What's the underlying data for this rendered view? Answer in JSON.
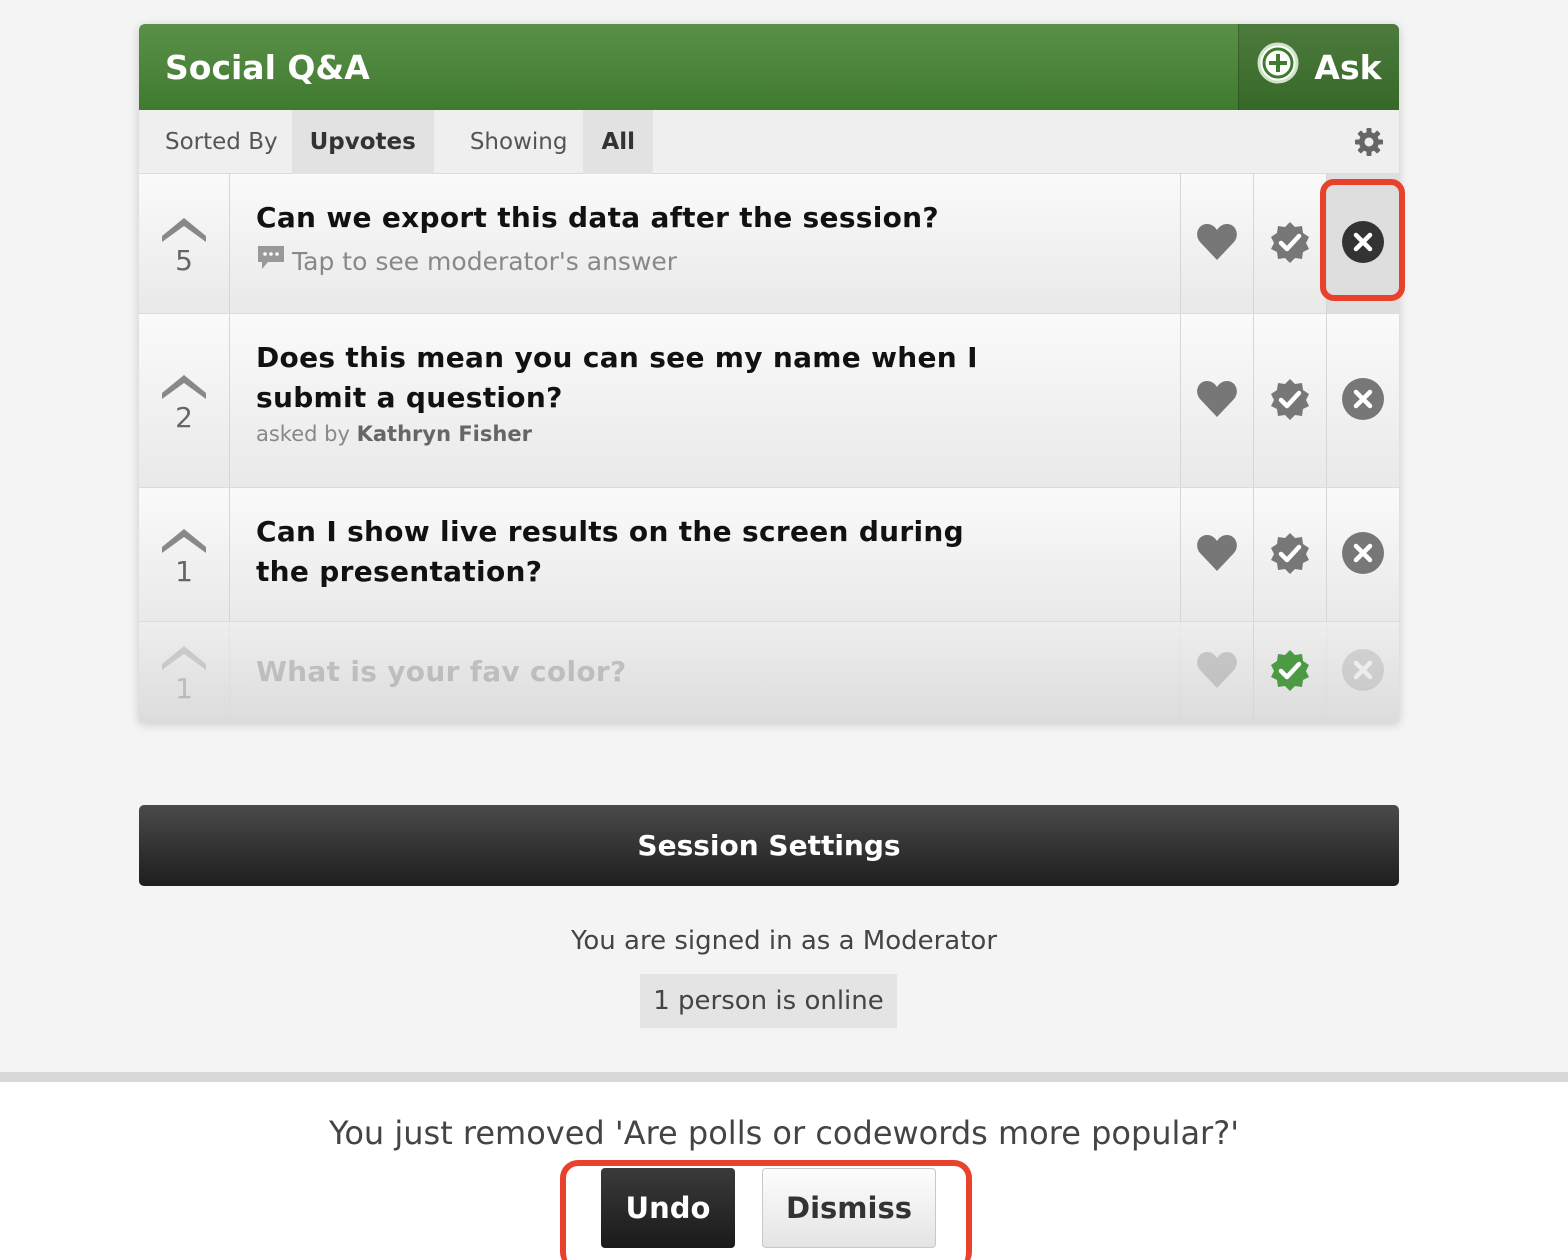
{
  "header": {
    "title": "Social Q&A",
    "ask_label": "Ask"
  },
  "toolbar": {
    "sorted_by_label": "Sorted By",
    "sorted_by_value": "Upvotes",
    "showing_label": "Showing",
    "showing_value": "All"
  },
  "questions": [
    {
      "votes": "5",
      "text": "Can we export this data after the session?",
      "sub": "Tap to see moderator's answer"
    },
    {
      "votes": "2",
      "text": "Does this mean you can see my name when I submit a question?",
      "asked_by_label": "asked by",
      "author": "Kathryn Fisher"
    },
    {
      "votes": "1",
      "text": "Can I show live results on the screen during the presentation?"
    },
    {
      "votes": "1",
      "text": "What is your fav color?",
      "approved": true
    }
  ],
  "session_settings_label": "Session Settings",
  "signed_in_text": "You are signed in as a Moderator",
  "online_text": "1 person is online",
  "footer": {
    "removed_text": "You just removed 'Are polls or codewords more popular?'",
    "undo_label": "Undo",
    "dismiss_label": "Dismiss"
  },
  "colors": {
    "header_green": "#4a8a3a",
    "approved_green": "#3f8f3a",
    "highlight_red": "#e8412c"
  },
  "icons": [
    "plus-circle-icon",
    "gear-icon",
    "upvote-chevron-icon",
    "comment-icon",
    "heart-icon",
    "check-badge-icon",
    "remove-x-icon"
  ]
}
